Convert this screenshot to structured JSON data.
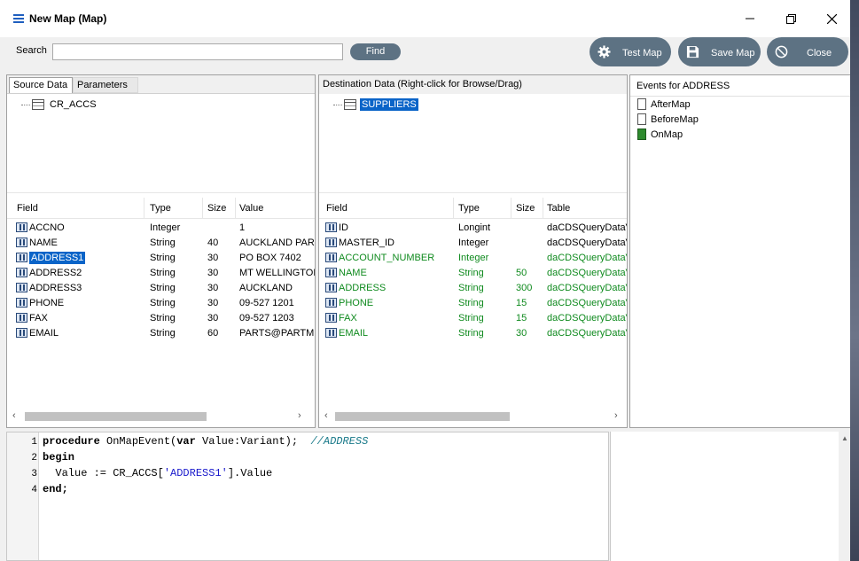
{
  "window": {
    "title": "New Map (Map)"
  },
  "toolbar": {
    "search_label": "Search",
    "search_value": "",
    "find_label": "Find",
    "test_map_label": "Test Map",
    "save_map_label": "Save Map",
    "close_label": "Close"
  },
  "source": {
    "tabs": [
      "Source Data",
      "Parameters"
    ],
    "tree_root": "CR_ACCS",
    "columns": [
      "Field",
      "Type",
      "Size",
      "Value"
    ],
    "rows": [
      {
        "field": "ACCNO",
        "type": "Integer",
        "size": "",
        "value": "1"
      },
      {
        "field": "NAME",
        "type": "String",
        "size": "40",
        "value": "AUCKLAND PAR."
      },
      {
        "field": "ADDRESS1",
        "type": "String",
        "size": "30",
        "value": "PO BOX 7402"
      },
      {
        "field": "ADDRESS2",
        "type": "String",
        "size": "30",
        "value": "MT WELLINGTON"
      },
      {
        "field": "ADDRESS3",
        "type": "String",
        "size": "30",
        "value": "AUCKLAND"
      },
      {
        "field": "PHONE",
        "type": "String",
        "size": "30",
        "value": "09-527 1201"
      },
      {
        "field": "FAX",
        "type": "String",
        "size": "30",
        "value": "09-527 1203"
      },
      {
        "field": "EMAIL",
        "type": "String",
        "size": "60",
        "value": "PARTS@PARTM."
      }
    ],
    "selected_field": "ADDRESS1"
  },
  "destination": {
    "header": "Destination Data  (Right-click for Browse/Drag)",
    "tree_root": "SUPPLIERS",
    "columns": [
      "Field",
      "Type",
      "Size",
      "Table"
    ],
    "rows": [
      {
        "field": "ID",
        "type": "Longint",
        "size": "",
        "table": "daCDSQueryDataV",
        "mapped": false
      },
      {
        "field": "MASTER_ID",
        "type": "Integer",
        "size": "",
        "table": "daCDSQueryDataV",
        "mapped": false
      },
      {
        "field": "ACCOUNT_NUMBER",
        "type": "Integer",
        "size": "",
        "table": "daCDSQueryDataV",
        "mapped": true
      },
      {
        "field": "NAME",
        "type": "String",
        "size": "50",
        "table": "daCDSQueryDataV",
        "mapped": true
      },
      {
        "field": "ADDRESS",
        "type": "String",
        "size": "300",
        "table": "daCDSQueryDataV",
        "mapped": true
      },
      {
        "field": "PHONE",
        "type": "String",
        "size": "15",
        "table": "daCDSQueryDataV",
        "mapped": true
      },
      {
        "field": "FAX",
        "type": "String",
        "size": "15",
        "table": "daCDSQueryDataV",
        "mapped": true
      },
      {
        "field": "EMAIL",
        "type": "String",
        "size": "30",
        "table": "daCDSQueryDataV",
        "mapped": true
      }
    ]
  },
  "events": {
    "header": "Events for ADDRESS",
    "items": [
      {
        "label": "AfterMap",
        "icon": "document-icon"
      },
      {
        "label": "BeforeMap",
        "icon": "document-icon"
      },
      {
        "label": "OnMap",
        "icon": "document-filled-icon"
      }
    ]
  },
  "editor": {
    "line_numbers": [
      "1",
      "2",
      "3",
      "4"
    ],
    "lines": [
      [
        "procedure",
        " OnMapEvent(",
        "var",
        " Value:Variant);  ",
        "//ADDRESS"
      ],
      [
        "begin"
      ],
      [
        "  Value := CR_ACCS[",
        "'ADDRESS1'",
        "].Value"
      ],
      [
        "end;"
      ]
    ]
  },
  "colors": {
    "accent_button": "#5d7283",
    "selection": "#0a64c8",
    "mapped_text": "#0f8a1e"
  }
}
